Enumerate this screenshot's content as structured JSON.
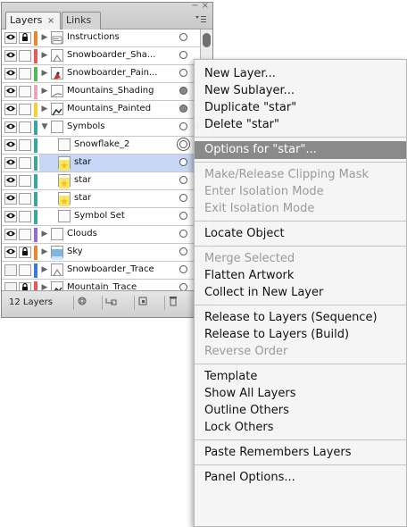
{
  "panel": {
    "tabs": [
      {
        "label": "Layers",
        "close": "×"
      },
      {
        "label": "Links"
      }
    ],
    "window_buttons": [
      "−",
      "×"
    ],
    "rows": [
      {
        "name": "Instructions",
        "color": "#e8882a",
        "locked": true,
        "expand": "▶",
        "thumb": "doc",
        "indent": 0,
        "target": "open"
      },
      {
        "name": "Snowboarder_Sha...",
        "color": "#e85a5a",
        "locked": false,
        "expand": "▶",
        "thumb": "snow",
        "indent": 0,
        "target": "open"
      },
      {
        "name": "Snowboarder_Pain...",
        "color": "#52b85a",
        "locked": false,
        "expand": "▶",
        "thumb": "red",
        "indent": 0,
        "target": "open"
      },
      {
        "name": "Mountains_Shading",
        "color": "#f0a0c0",
        "locked": false,
        "expand": "▶",
        "thumb": "line",
        "indent": 0,
        "target": "filled"
      },
      {
        "name": "Mountains_Painted",
        "color": "#f2d03a",
        "locked": false,
        "expand": "▶",
        "thumb": "mtn",
        "indent": 0,
        "target": "filled"
      },
      {
        "name": "Symbols",
        "color": "#3aa6a0",
        "locked": false,
        "expand": "▼",
        "thumb": "blank",
        "indent": 0,
        "target": "open",
        "sel": "#3aa6a0"
      },
      {
        "name": "Snowflake_2",
        "color": "#3aa6a0",
        "locked": false,
        "expand": "",
        "thumb": "blank",
        "indent": 1,
        "target": "double",
        "sel": "#3aa6a0"
      },
      {
        "name": "star",
        "color": "#3aa6a0",
        "locked": false,
        "expand": "",
        "thumb": "star",
        "indent": 1,
        "target": "open",
        "selected": true
      },
      {
        "name": "star",
        "color": "#3aa6a0",
        "locked": false,
        "expand": "",
        "thumb": "star",
        "indent": 1,
        "target": "open"
      },
      {
        "name": "star",
        "color": "#3aa6a0",
        "locked": false,
        "expand": "",
        "thumb": "star",
        "indent": 1,
        "target": "open"
      },
      {
        "name": "Symbol Set",
        "color": "#3aa6a0",
        "locked": false,
        "expand": "",
        "thumb": "blank",
        "indent": 1,
        "target": "open"
      },
      {
        "name": "Clouds",
        "color": "#9a6ad0",
        "locked": false,
        "expand": "▶",
        "thumb": "blank",
        "indent": 0,
        "target": "open"
      },
      {
        "name": "Sky",
        "color": "#e8882a",
        "locked": true,
        "expand": "▶",
        "thumb": "sky",
        "indent": 0,
        "target": "open"
      },
      {
        "name": "Snowboarder_Trace",
        "color": "#3a7ad8",
        "locked": false,
        "expand": "▶",
        "thumb": "snow",
        "indent": 0,
        "target": "open",
        "hidden": true
      },
      {
        "name": "Mountain_Trace",
        "color": "#e85a5a",
        "locked": true,
        "expand": "▶",
        "thumb": "mtn",
        "indent": 0,
        "target": "open",
        "hidden": true
      }
    ],
    "layer_count": "12 Layers",
    "bottom_buttons": [
      "make-clip-mask",
      "new-sublayer",
      "new-layer",
      "delete"
    ]
  },
  "menu": {
    "items": [
      {
        "label": "New Layer...",
        "enabled": true
      },
      {
        "label": "New Sublayer...",
        "enabled": true
      },
      {
        "label": "Duplicate \"star\"",
        "enabled": true
      },
      {
        "label": "Delete \"star\"",
        "enabled": true
      },
      {
        "sep": true
      },
      {
        "label": "Options for \"star\"...",
        "enabled": true,
        "highlight": true
      },
      {
        "sep": true
      },
      {
        "label": "Make/Release Clipping Mask",
        "enabled": false
      },
      {
        "label": "Enter Isolation Mode",
        "enabled": false
      },
      {
        "label": "Exit Isolation Mode",
        "enabled": false
      },
      {
        "sep": true
      },
      {
        "label": "Locate Object",
        "enabled": true
      },
      {
        "sep": true
      },
      {
        "label": "Merge Selected",
        "enabled": false
      },
      {
        "label": "Flatten Artwork",
        "enabled": true
      },
      {
        "label": "Collect in New Layer",
        "enabled": true
      },
      {
        "sep": true
      },
      {
        "label": "Release to Layers (Sequence)",
        "enabled": true
      },
      {
        "label": "Release to Layers (Build)",
        "enabled": true
      },
      {
        "label": "Reverse Order",
        "enabled": false
      },
      {
        "sep": true
      },
      {
        "label": "Template",
        "enabled": true
      },
      {
        "label": "Show All Layers",
        "enabled": true
      },
      {
        "label": "Outline Others",
        "enabled": true
      },
      {
        "label": "Lock Others",
        "enabled": true
      },
      {
        "sep": true
      },
      {
        "label": "Paste Remembers Layers",
        "enabled": true
      },
      {
        "sep": true
      },
      {
        "label": "Panel Options...",
        "enabled": true
      }
    ]
  }
}
